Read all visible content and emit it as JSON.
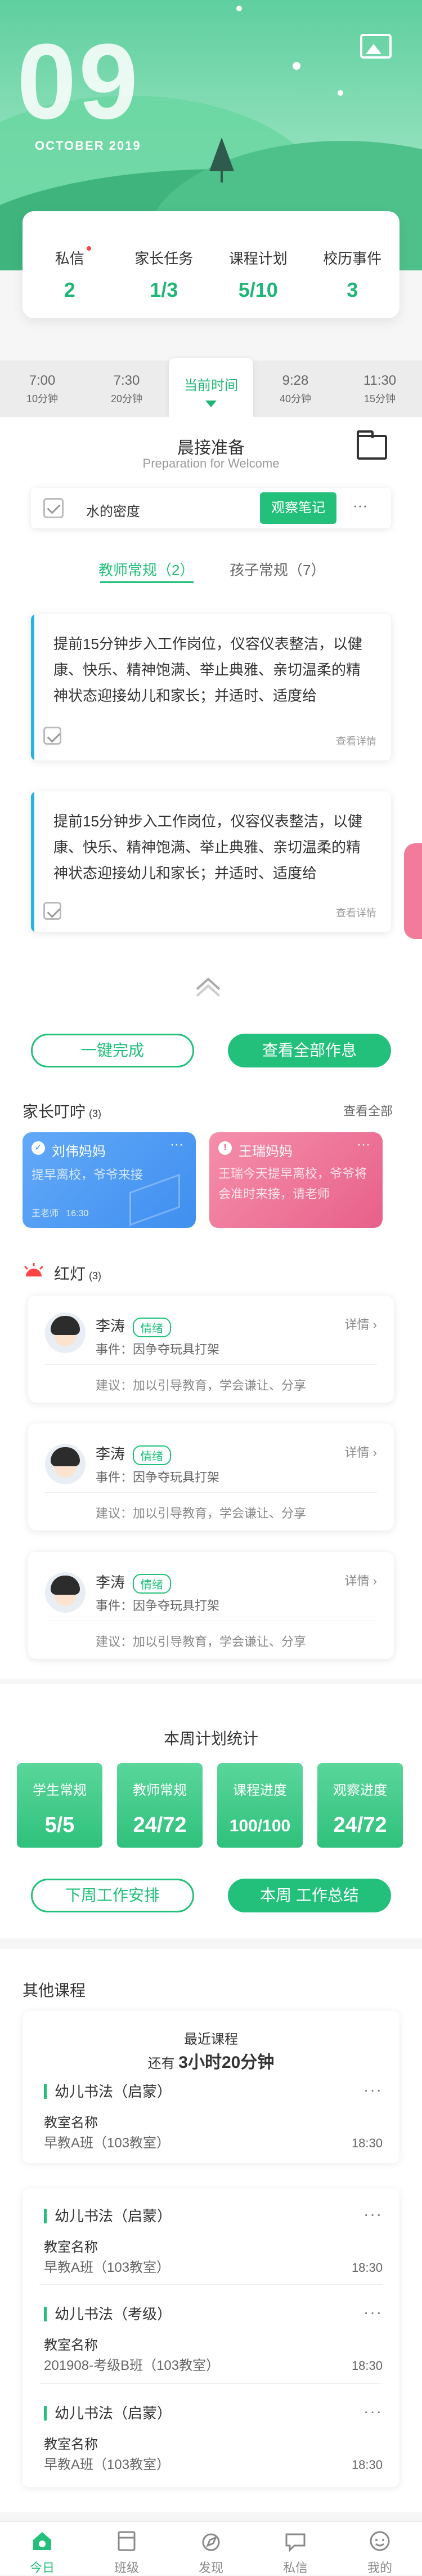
{
  "hero": {
    "day": "09",
    "month_year": "OCTOBER  2019"
  },
  "stats": [
    {
      "label": "私信",
      "value": "2"
    },
    {
      "label": "家长任务",
      "value": "1/3"
    },
    {
      "label": "课程计划",
      "value": "5/10"
    },
    {
      "label": "校历事件",
      "value": "3"
    }
  ],
  "timeline": [
    {
      "time": "7:00",
      "sub": "10分钟"
    },
    {
      "time": "7:30",
      "sub": "20分钟"
    },
    {
      "time": "当前时间",
      "sub": ""
    },
    {
      "time": "9:28",
      "sub": "40分钟"
    },
    {
      "time": "11:30",
      "sub": "15分钟"
    }
  ],
  "morning": {
    "title": "晨接准备",
    "subtitle": "Preparation for Welcome"
  },
  "task": {
    "text": "水的密度",
    "button": "观察笔记",
    "more": "···"
  },
  "tabs": {
    "teacher": "教师常规（2）",
    "child": "孩子常规（7）"
  },
  "notes": [
    {
      "text": "提前15分钟步入工作岗位，仪容仪表整洁，以健康、快乐、精神饱满、举止典雅、亲切温柔的精神状态迎接幼儿和家长；并适时、适度给",
      "more": "查看详情"
    },
    {
      "text": "提前15分钟步入工作岗位，仪容仪表整洁，以健康、快乐、精神饱满、举止典雅、亲切温柔的精神状态迎接幼儿和家长；并适时、适度给",
      "more": "查看详情"
    }
  ],
  "actions": {
    "complete": "一键完成",
    "view_all": "查看全部作息"
  },
  "parent_section": {
    "title": "家长叮咛",
    "count": "(3)",
    "view_all": "查看全部"
  },
  "parent_cards": [
    {
      "name": "刘伟妈妈",
      "text": "提早离校，爷爷来接",
      "teacher": "王老师",
      "time": "16:30",
      "more": "···",
      "color": "#4f9df5"
    },
    {
      "name": "王瑞妈妈",
      "text": "王瑞今天提早离校，爷爷将会准时来接，请老师",
      "more": "···",
      "color": "#ee6f92"
    }
  ],
  "red_section": {
    "title": "红灯",
    "count": "(3)"
  },
  "red_cards": [
    {
      "name": "李涛",
      "badge": "情绪",
      "event": "事件：因争夺玩具打架",
      "suggest": "建议：加以引导教育，学会谦让、分享",
      "detail": "详情"
    },
    {
      "name": "李涛",
      "badge": "情绪",
      "event": "事件：因争夺玩具打架",
      "suggest": "建议：加以引导教育，学会谦让、分享",
      "detail": "详情"
    },
    {
      "name": "李涛",
      "badge": "情绪",
      "event": "事件：因争夺玩具打架",
      "suggest": "建议：加以引导教育，学会谦让、分享",
      "detail": "详情"
    }
  ],
  "week": {
    "title": "本周计划统计",
    "boxes": [
      {
        "label": "学生常规",
        "value": "5/5"
      },
      {
        "label": "教师常规",
        "value": "24/72"
      },
      {
        "label": "课程进度",
        "value": "100/100"
      },
      {
        "label": "观察进度",
        "value": "24/72"
      }
    ],
    "btn_next": "下周工作安排",
    "btn_summary": "本周 工作总结"
  },
  "other": {
    "title": "其他课程",
    "recent_label": "最近课程",
    "remain_prefix": "还有",
    "remain_value": "3小时20分钟",
    "first": {
      "name": "幼儿书法（启蒙）",
      "label": "教室名称",
      "cls": "早教A班（103教室）",
      "time": "18:30"
    },
    "list": [
      {
        "name": "幼儿书法（启蒙）",
        "label": "教室名称",
        "cls": "早教A班（103教室）",
        "time": "18:30"
      },
      {
        "name": "幼儿书法（考级）",
        "label": "教室名称",
        "cls": "201908-考级B班（103教室）",
        "time": "18:30"
      },
      {
        "name": "幼儿书法（启蒙）",
        "label": "教室名称",
        "cls": "早教A班（103教室）",
        "time": "18:30"
      }
    ]
  },
  "nav": [
    {
      "label": "今日",
      "icon": "home-icon"
    },
    {
      "label": "班级",
      "icon": "class-icon"
    },
    {
      "label": "发现",
      "icon": "discover-icon"
    },
    {
      "label": "私信",
      "icon": "message-icon"
    },
    {
      "label": "我的",
      "icon": "profile-icon"
    }
  ],
  "colors": {
    "accent": "#22c07a",
    "blue": "#4f9df5",
    "pink": "#ee6f92",
    "note_bar": "#25b3e6"
  }
}
